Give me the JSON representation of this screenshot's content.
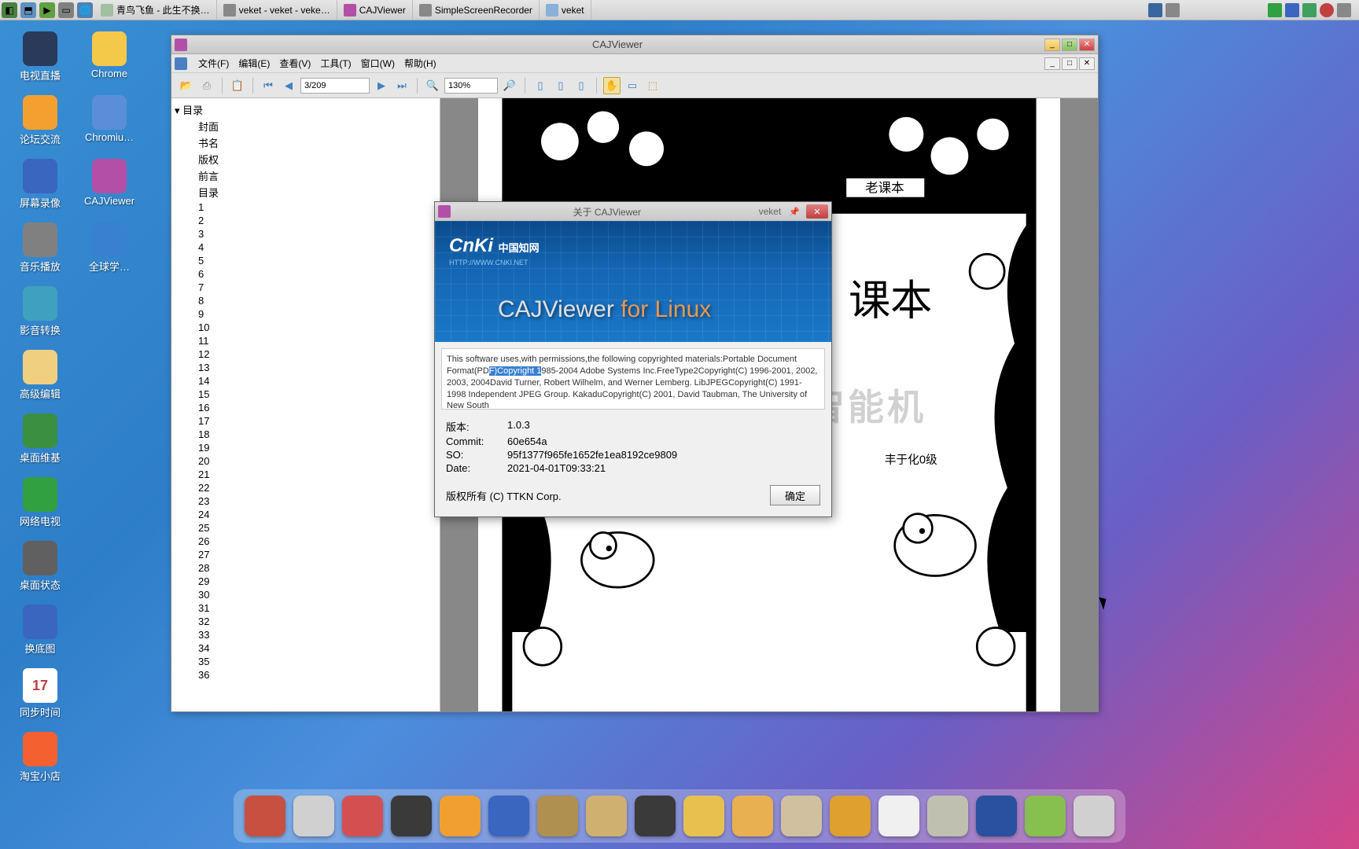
{
  "taskbar": {
    "items": [
      {
        "label": "青鸟飞鱼 - 此生不换…",
        "color": "#a0c0a0"
      },
      {
        "label": "veket - veket - veke…",
        "color": "#888"
      },
      {
        "label": "CAJViewer",
        "color": "#b44fa8"
      },
      {
        "label": "SimpleScreenRecorder",
        "color": "#888"
      },
      {
        "label": "veket",
        "color": "#88b0d8"
      }
    ]
  },
  "desktop": {
    "icons": [
      [
        {
          "label": "电视直播",
          "color": "#2a3a5a"
        },
        {
          "label": "Chrome",
          "color": "#f4c94a"
        }
      ],
      [
        {
          "label": "论坛交流",
          "color": "#f4a030"
        },
        {
          "label": "Chromiu…",
          "color": "#5a8ed8"
        }
      ],
      [
        {
          "label": "屏幕录像",
          "color": "#3a66c0"
        },
        {
          "label": "CAJViewer",
          "color": "#b44fa8"
        }
      ],
      [
        {
          "label": "音乐播放",
          "color": "#808080"
        },
        {
          "label": "全球学…",
          "color": "#3a80d0"
        }
      ],
      [
        {
          "label": "影音转换",
          "color": "#40a0c0"
        }
      ],
      [
        {
          "label": "高级编辑",
          "color": "#f0d080"
        }
      ],
      [
        {
          "label": "桌面维基",
          "color": "#3a9040"
        }
      ],
      [
        {
          "label": "网络电视",
          "color": "#30a040"
        }
      ],
      [
        {
          "label": "桌面状态",
          "color": "#606060"
        }
      ],
      [
        {
          "label": "换底图",
          "color": "#3a66c0"
        }
      ],
      [
        {
          "label": "同步时间",
          "color": "#f0f0f0"
        }
      ],
      [
        {
          "label": "淘宝小店",
          "color": "#f46030"
        }
      ]
    ],
    "calendar_day": "17"
  },
  "caj": {
    "title": "CAJViewer",
    "menu": [
      "文件(F)",
      "编辑(E)",
      "查看(V)",
      "工具(T)",
      "窗口(W)",
      "帮助(H)"
    ],
    "page_field": "3/209",
    "zoom_field": "130%",
    "tree_root": "目录",
    "tree_items": [
      "封面",
      "书名",
      "版权",
      "前言",
      "目录",
      "1",
      "2",
      "3",
      "4",
      "5",
      "6",
      "7",
      "8",
      "9",
      "10",
      "11",
      "12",
      "13",
      "14",
      "15",
      "16",
      "17",
      "18",
      "19",
      "20",
      "21",
      "22",
      "23",
      "24",
      "25",
      "26",
      "27",
      "28",
      "29",
      "30",
      "31",
      "32",
      "33",
      "34",
      "35",
      "36"
    ],
    "banner_text": "老课本",
    "page_title": "课本",
    "page_sub": "丰于化0级",
    "watermark": "微型超人工智能机"
  },
  "about": {
    "title": "关于 CAJViewer",
    "title_extra": "veket",
    "logo": "CnKi",
    "logo_cn": "中国知网",
    "logo_url": "HTTP://WWW.CNKI.NET",
    "product": "CAJViewer",
    "product_suffix": "for Linux",
    "text_pre": "This software uses,with permissions,the following copyrighted materials:Portable Document Format(PD",
    "text_hl": "F)Copyright 1",
    "text_post": "985-2004 Adobe Systems Inc.FreeType2Copyright(C) 1996-2001, 2002, 2003, 2004David Turner, Robert Wilhelm, and Werner Lemberg. LibJPEGCopyright(C) 1991-1998 Independent JPEG Group. KakaduCopyright(C) 2001, David Taubman, The University of New South",
    "rows": [
      {
        "k": "版本:",
        "v": "1.0.3"
      },
      {
        "k": "Commit:",
        "v": "60e654a"
      },
      {
        "k": "SO:",
        "v": "95f1377f965fe1652fe1ea8192ce9809"
      },
      {
        "k": "Date:",
        "v": "2021-04-01T09:33:21"
      }
    ],
    "copyright": "版权所有 (C) TTKN Corp.",
    "ok": "确定"
  },
  "dock_colors": [
    "#c85040",
    "#d0d0d0",
    "#d45050",
    "#3a3a3a",
    "#f0a030",
    "#3a66c0",
    "#b09050",
    "#d0b070",
    "#3a3a3a",
    "#e8c050",
    "#e8b050",
    "#d0c0a0",
    "#e0a030",
    "#f0f0f0",
    "#c0c0b0",
    "#2a50a0",
    "#88c050",
    "#d0d0d0"
  ]
}
